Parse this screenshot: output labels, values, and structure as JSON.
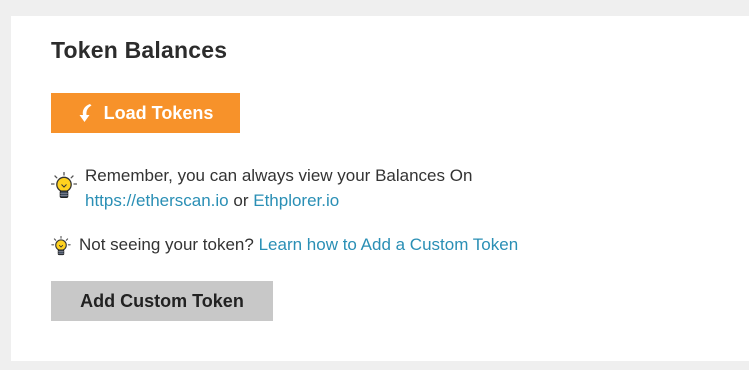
{
  "section": {
    "title": "Token Balances"
  },
  "load_button": {
    "label": "Load Tokens",
    "icon": "load-arrow-icon",
    "color": "#f7922a"
  },
  "tips": {
    "balances": {
      "text": "Remember, you can always view your Balances On",
      "link1": "https://etherscan.io",
      "separator": "or",
      "link2": "Ethplorer.io",
      "icon": "lightbulb-icon"
    },
    "custom_token": {
      "text": "Not seeing your token?",
      "link": "Learn how to Add a Custom Token",
      "icon": "lightbulb-icon"
    }
  },
  "add_button": {
    "label": "Add Custom Token",
    "color": "#c8c8c8"
  },
  "colors": {
    "link": "#2a8fb5",
    "text": "#333333"
  }
}
